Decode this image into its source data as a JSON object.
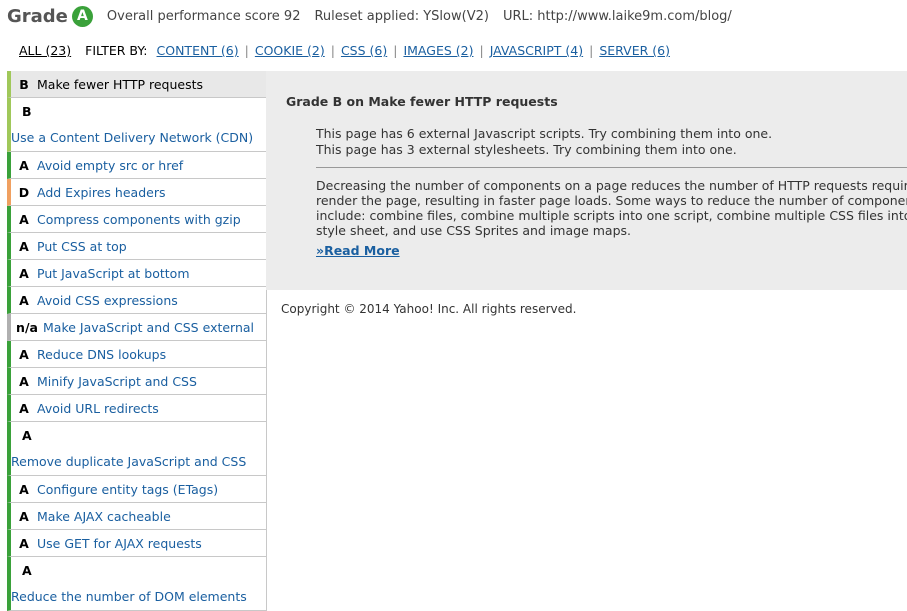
{
  "header": {
    "grade_word": "Grade",
    "grade_letter": "A",
    "score_text": "Overall performance score 92",
    "ruleset_text": "Ruleset applied: YSlow(V2)",
    "url_text": "URL: http://www.laike9m.com/blog/"
  },
  "filters": {
    "all": "ALL (23)",
    "label": "FILTER BY:",
    "items": [
      "CONTENT (6)",
      "COOKIE (2)",
      "CSS (6)",
      "IMAGES (2)",
      "JAVASCRIPT (4)",
      "SERVER (6)"
    ]
  },
  "rules": [
    {
      "grade": "B",
      "name": "Make fewer HTTP requests"
    },
    {
      "grade": "B",
      "name": "Use a Content Delivery Network (CDN)"
    },
    {
      "grade": "A",
      "name": "Avoid empty src or href"
    },
    {
      "grade": "D",
      "name": "Add Expires headers"
    },
    {
      "grade": "A",
      "name": "Compress components with gzip"
    },
    {
      "grade": "A",
      "name": "Put CSS at top"
    },
    {
      "grade": "A",
      "name": "Put JavaScript at bottom"
    },
    {
      "grade": "A",
      "name": "Avoid CSS expressions"
    },
    {
      "grade": "n/a",
      "name": "Make JavaScript and CSS external"
    },
    {
      "grade": "A",
      "name": "Reduce DNS lookups"
    },
    {
      "grade": "A",
      "name": "Minify JavaScript and CSS"
    },
    {
      "grade": "A",
      "name": "Avoid URL redirects"
    },
    {
      "grade": "A",
      "name": "Remove duplicate JavaScript and CSS"
    },
    {
      "grade": "A",
      "name": "Configure entity tags (ETags)"
    },
    {
      "grade": "A",
      "name": "Make AJAX cacheable"
    },
    {
      "grade": "A",
      "name": "Use GET for AJAX requests"
    },
    {
      "grade": "A",
      "name": "Reduce the number of DOM elements"
    }
  ],
  "detail": {
    "title": "Grade B on Make fewer HTTP requests",
    "msg1": "This page has 6 external Javascript scripts. Try combining them into one.",
    "msg2": "This page has 3 external stylesheets. Try combining them into one.",
    "description": "Decreasing the number of components on a page reduces the number of HTTP requests required to render the page, resulting in faster page loads. Some ways to reduce the number of components include: combine files, combine multiple scripts into one script, combine multiple CSS files into one style sheet, and use CSS Sprites and image maps.",
    "read_more": "»Read More"
  },
  "copyright": "Copyright © 2014 Yahoo! Inc. All rights reserved.",
  "colors": {
    "grade_a": "#3aa13a",
    "grade_b": "#a0c85a",
    "grade_d": "#f0a060",
    "grade_na": "#b0b0b0",
    "link": "#1a5fa0",
    "panel_bg": "#ececec"
  }
}
